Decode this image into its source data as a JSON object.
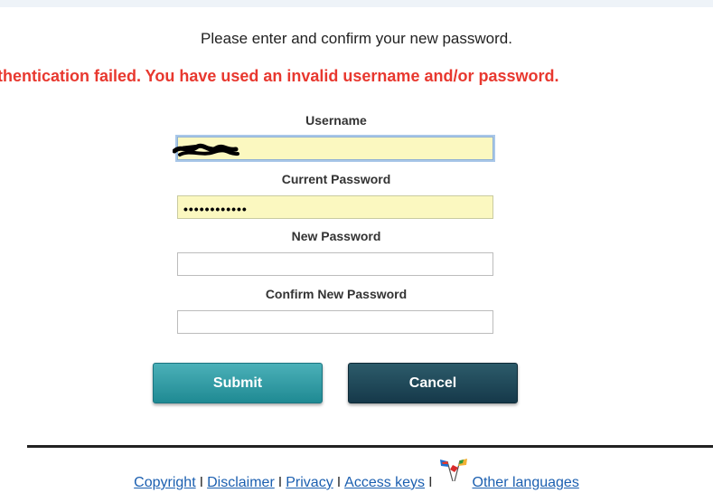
{
  "instruction": "Please enter and confirm your new password.",
  "error_message": "uthentication failed. You have used an invalid username and/or password.",
  "form": {
    "username_label": "Username",
    "username_value": "",
    "current_password_label": "Current Password",
    "current_password_value": "••••••••••••",
    "new_password_label": "New Password",
    "new_password_value": "",
    "confirm_password_label": "Confirm New Password",
    "confirm_password_value": ""
  },
  "buttons": {
    "submit": "Submit",
    "cancel": "Cancel"
  },
  "footer": {
    "links": [
      "Copyright",
      "Disclaimer",
      "Privacy",
      "Access keys",
      "Other languages"
    ],
    "separator": "I"
  },
  "colors": {
    "error": "#e8382f",
    "autofill_bg": "#fbf8c0",
    "submit_button": "#2e9aa3",
    "cancel_button": "#1f4858",
    "link": "#1b5fb0"
  },
  "icons": [
    "scribble-redaction-icon",
    "flags-icon"
  ]
}
